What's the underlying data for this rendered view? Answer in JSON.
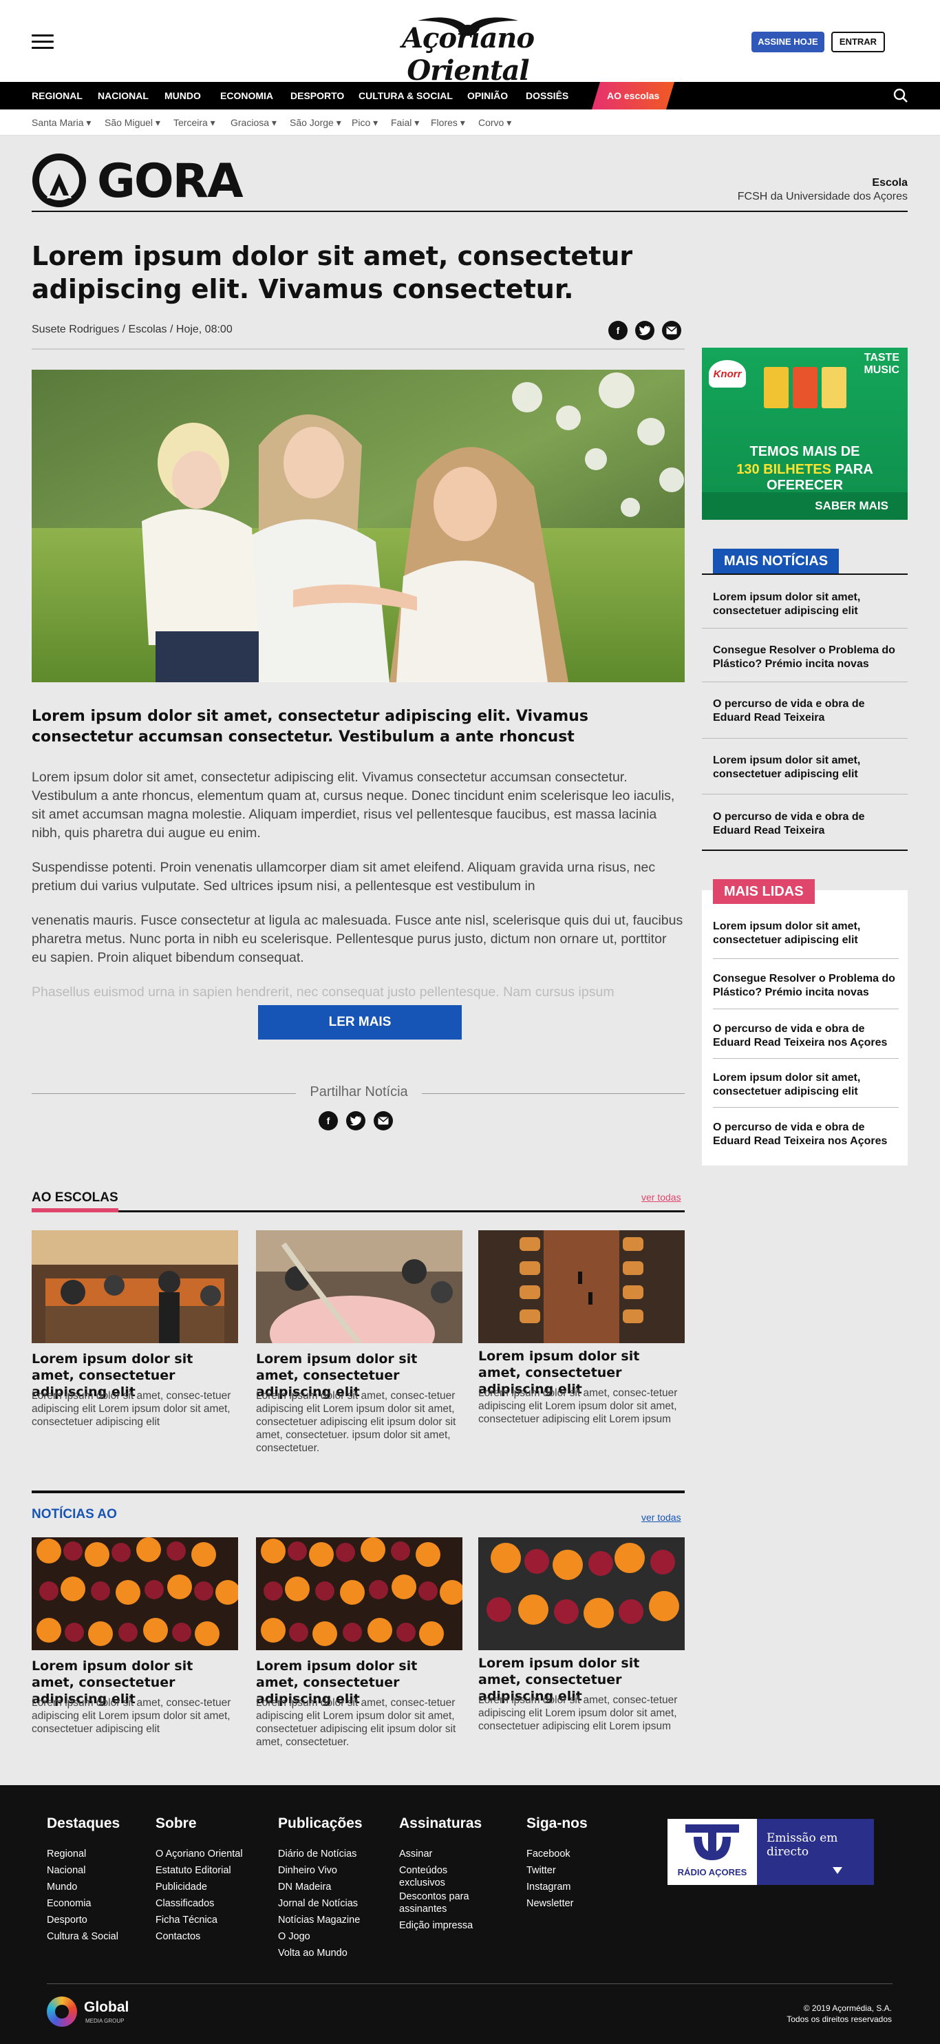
{
  "header": {
    "logo_text": "Açoriano Oriental",
    "subscribe_label": "ASSINE HOJE",
    "login_label": "ENTRAR"
  },
  "nav": {
    "items": [
      "REGIONAL",
      "NACIONAL",
      "MUNDO",
      "ECONOMIA",
      "DESPORTO",
      "CULTURA & SOCIAL",
      "OPINIÃO",
      "DOSSIÊS"
    ],
    "special": "AO escolas"
  },
  "subnav": {
    "items": [
      "Santa Maria ▾",
      "São Miguel ▾",
      "Terceira ▾",
      "Graciosa ▾",
      "São Jorge ▾",
      "Pico ▾",
      "Faial ▾",
      "Flores ▾",
      "Corvo ▾"
    ]
  },
  "agora": {
    "logo_text": "GORA",
    "school_label": "Escola",
    "school_name": "FCSH da Universidade dos Açores"
  },
  "article": {
    "headline": "Lorem ipsum dolor sit amet, consectetur adipiscing elit. Vivamus consectetur.",
    "byline": "Susete Rodrigues / Escolas /  Hoje, 08:00",
    "lead": "Lorem ipsum dolor sit amet, consectetur adipiscing elit. Vivamus consectetur accumsan consectetur. Vestibulum a ante rhoncust",
    "paragraphs": [
      "Lorem ipsum dolor sit amet, consectetur adipiscing elit. Vivamus consectetur accumsan consectetur. Vestibulum a ante rhoncus, elementum quam at, cursus neque. Donec tincidunt enim scelerisque leo iaculis, sit amet accumsan magna molestie. Aliquam imperdiet, risus vel pellentesque faucibus, est massa lacinia nibh, quis pharetra dui augue eu enim.",
      "Suspendisse potenti. Proin venenatis ullamcorper diam sit amet eleifend. Aliquam gravida urna risus, nec pretium dui varius vulputate. Sed ultrices ipsum nisi, a pellentesque est vestibulum in",
      "venenatis mauris. Fusce consectetur at ligula ac malesuada. Fusce ante nisl, scelerisque quis dui ut, faucibus pharetra metus. Nunc porta in nibh eu scelerisque. Pellentesque purus justo, dictum non ornare ut, porttitor eu sapien. Proin aliquet bibendum consequat."
    ],
    "fade_text": "Phasellus euismod urna in sapien hendrerit, nec consequat justo pellentesque. Nam cursus ipsum",
    "read_more": "LER MAIS",
    "share_title": "Partilhar Notícia"
  },
  "ad": {
    "brand": "Knorr",
    "tag1": "TASTE",
    "tag2": "MUSIC",
    "line1": "TEMOS MAIS DE",
    "line2a": "130 BILHETES",
    "line2b": " PARA OFERECER",
    "cta": "SABER MAIS"
  },
  "mais_noticias": {
    "title": "MAIS NOTÍCIAS",
    "items": [
      "Lorem ipsum dolor sit amet, consectetuer adipiscing elit",
      "Consegue Resolver o Problema do Plástico? Prémio incita novas",
      "O percurso de vida e obra de Eduard Read Teixeira",
      "Lorem ipsum dolor sit amet, consectetuer adipiscing elit",
      "O percurso de vida e obra de Eduard Read Teixeira"
    ]
  },
  "mais_lidas": {
    "title": "MAIS LIDAS",
    "items": [
      "Lorem ipsum dolor sit amet, consectetuer adipiscing elit",
      "Consegue Resolver o Problema do Plástico? Prémio incita novas",
      "O percurso de vida e obra de Eduard Read Teixeira nos Açores",
      "Lorem ipsum dolor sit amet, consectetuer adipiscing elit",
      "O percurso de vida e obra de Eduard Read Teixeira nos Açores"
    ]
  },
  "ao_escolas": {
    "title": "AO ESCOLAS",
    "ver_todas": "ver todas",
    "cards": [
      {
        "title": "Lorem ipsum dolor sit amet, consectetuer adipiscing elit",
        "text": "Lorem ipsum dolor sit amet, consec-tetuer adipiscing elit Lorem ipsum dolor sit amet, consectetuer adipiscing elit"
      },
      {
        "title": "Lorem ipsum dolor sit amet, consectetuer adipiscing elit",
        "text": "Lorem ipsum dolor sit amet, consec-tetuer adipiscing elit Lorem ipsum dolor sit amet, consectetuer adipiscing elit ipsum dolor sit amet, consectetuer. ipsum dolor sit amet, consectetuer."
      },
      {
        "title": "Lorem ipsum dolor sit amet, consectetuer adipiscing elit",
        "text": "Lorem ipsum dolor sit amet, consec-tetuer adipiscing elit Lorem ipsum dolor sit amet, consectetuer adipiscing elit Lorem ipsum"
      }
    ]
  },
  "noticias_ao": {
    "title": "NOTÍCIAS AO",
    "ver_todas": "ver todas",
    "cards": [
      {
        "title": "Lorem ipsum dolor sit amet, consectetuer adipiscing elit",
        "text": "Lorem ipsum dolor sit amet, consec-tetuer adipiscing elit Lorem ipsum dolor sit amet, consectetuer adipiscing elit"
      },
      {
        "title": "Lorem ipsum dolor sit amet, consectetuer adipiscing elit",
        "text": "Lorem ipsum dolor sit amet, consec-tetuer adipiscing elit Lorem ipsum dolor sit amet, consectetuer adipiscing elit ipsum dolor sit amet, consectetuer."
      },
      {
        "title": "Lorem ipsum dolor sit amet, consectetuer adipiscing elit",
        "text": "Lorem ipsum dolor sit amet, consec-tetuer adipiscing elit Lorem ipsum dolor sit amet, consectetuer adipiscing elit Lorem ipsum"
      }
    ]
  },
  "footer": {
    "columns": [
      {
        "title": "Destaques",
        "links": [
          "Regional",
          "Nacional",
          "Mundo",
          "Economia",
          "Desporto",
          "Cultura & Social"
        ]
      },
      {
        "title": "Sobre",
        "links": [
          "O Açoriano Oriental",
          "Estatuto Editorial",
          "Publicidade",
          "Classificados",
          "Ficha Técnica",
          "Contactos"
        ]
      },
      {
        "title": "Publicações",
        "links": [
          "Diário de Notícias",
          "Dinheiro Vivo",
          "DN Madeira",
          "Jornal de Notícias",
          "Notícias Magazine",
          "O Jogo",
          "Volta ao Mundo"
        ]
      },
      {
        "title": "Assinaturas",
        "links": [
          "Assinar",
          "Conteúdos exclusivos",
          "Descontos para assinantes",
          "Edição impressa"
        ]
      },
      {
        "title": "Siga-nos",
        "links": [
          "Facebook",
          "Twitter",
          "Instagram",
          "Newsletter"
        ]
      }
    ],
    "radio_name": "RÁDIO AÇORES",
    "radio_live": "Emissão em directo",
    "group_name": "Global",
    "group_sub": "MEDIA GROUP",
    "copyright": "© 2019 Açormédia, S.A.",
    "rights": "Todos os direitos reservados"
  },
  "colors": {
    "nav_bg": "#000000",
    "accent_blue": "#1654b5",
    "accent_pink": "#e0456c",
    "footer_bg": "#111111"
  }
}
